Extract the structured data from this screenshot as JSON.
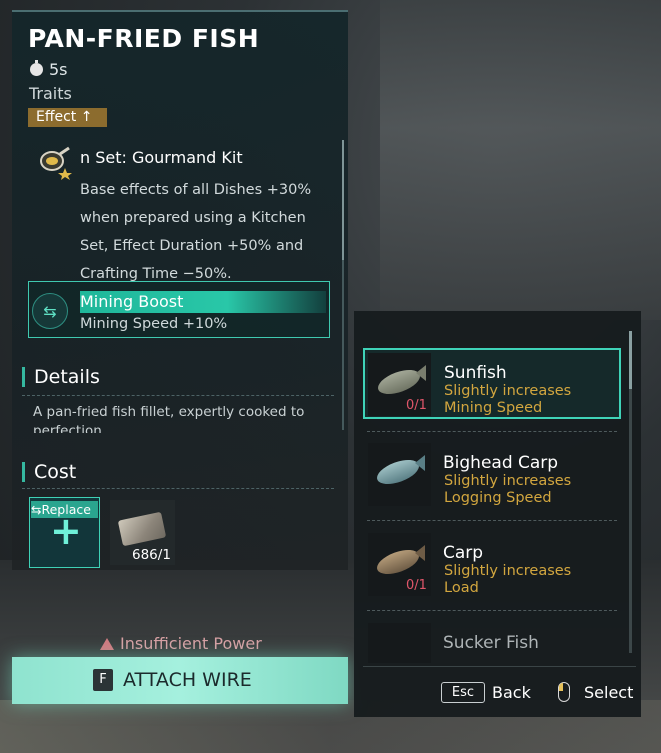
{
  "item": {
    "title": "PAN-FRIED FISH",
    "time": "5s",
    "traits_label": "Traits",
    "effect_tag": "Effect ↑",
    "set_name": "n Set: Gourmand   Kit",
    "set_desc": "Base effects of all Dishes +30% when prepared using a Kitchen Set, Effect Duration +50% and Crafting Time −50%.",
    "boost_name": "Mining Boost",
    "boost_desc": "Mining Speed +10%",
    "details_title": "Details",
    "details_text": "A pan-fried fish fillet, expertly cooked to perfection.",
    "cost_title": "Cost",
    "replace_label": "Replace",
    "material_count": "686/1",
    "warning": "Insufficient Power",
    "attach_key": "F",
    "attach_label": "ATTACH WIRE"
  },
  "fish_list": [
    {
      "name": "Sunfish",
      "effect1": "Slightly increases",
      "effect2": "Mining Speed",
      "count": "0/1",
      "selected": true
    },
    {
      "name": "Bighead Carp",
      "effect1": "Slightly increases",
      "effect2": "Logging Speed",
      "count": "",
      "selected": false
    },
    {
      "name": "Carp",
      "effect1": "Slightly increases",
      "effect2": "Load",
      "count": "0/1",
      "selected": false
    },
    {
      "name": "Sucker Fish",
      "effect1": "",
      "effect2": "",
      "count": "",
      "selected": false
    }
  ],
  "footer": {
    "esc_key": "Esc",
    "back_label": "Back",
    "select_label": "Select"
  },
  "colors": {
    "accent": "#3fd3b8",
    "effect_text": "#d2a63f",
    "count_red": "#e0566a"
  }
}
